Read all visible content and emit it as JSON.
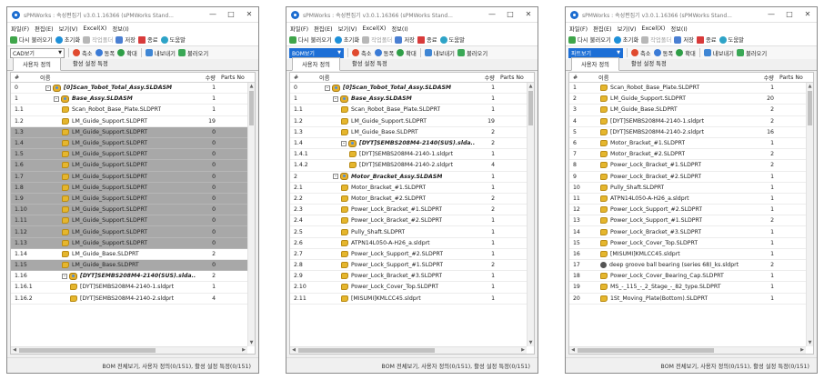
{
  "windows": [
    {
      "title": "sPMWorks : 속성편집기 v3.0.1.16366 (sPMWorks Stand...",
      "menu": [
        "파일(F)",
        "편집(E)",
        "보기(V)",
        "Excel(X)",
        "정보(I)"
      ],
      "toolbar": [
        "다시 불러오기",
        "초기화",
        "작업폴더",
        "저장",
        "종료",
        "도움말"
      ],
      "view_select": "CAD보기",
      "view_selected": false,
      "zoom": [
        "축소",
        "동폭",
        "확대"
      ],
      "io": [
        "내보내기",
        "불러오기"
      ],
      "tabs": [
        "사용자 정의",
        "활성 설정 특정"
      ],
      "columns": {
        "num": "#",
        "name": "이름",
        "qty": "수량",
        "parts": "Parts No"
      },
      "rows": [
        {
          "num": "0",
          "name": "[0]Scan_Tobot_Total_Assy.SLDASM",
          "qty": "1",
          "kind": "asm",
          "indent": 0,
          "hl": false,
          "exp": "-"
        },
        {
          "num": "1",
          "name": "Base_Assy.SLDASM",
          "qty": "1",
          "kind": "asm",
          "indent": 1,
          "hl": false,
          "exp": "-"
        },
        {
          "num": "1.1",
          "name": "Scan_Robot_Base_Plate.SLDPRT",
          "qty": "1",
          "kind": "part",
          "indent": 2,
          "hl": false
        },
        {
          "num": "1.2",
          "name": "LM_Guide_Support.SLDPRT",
          "qty": "19",
          "kind": "part",
          "indent": 2,
          "hl": false
        },
        {
          "num": "1.3",
          "name": "LM_Guide_Support.SLDPRT",
          "qty": "0",
          "kind": "part",
          "indent": 2,
          "hl": true
        },
        {
          "num": "1.4",
          "name": "LM_Guide_Support.SLDPRT",
          "qty": "0",
          "kind": "part",
          "indent": 2,
          "hl": true
        },
        {
          "num": "1.5",
          "name": "LM_Guide_Support.SLDPRT",
          "qty": "0",
          "kind": "part",
          "indent": 2,
          "hl": true
        },
        {
          "num": "1.6",
          "name": "LM_Guide_Support.SLDPRT",
          "qty": "0",
          "kind": "part",
          "indent": 2,
          "hl": true
        },
        {
          "num": "1.7",
          "name": "LM_Guide_Support.SLDPRT",
          "qty": "0",
          "kind": "part",
          "indent": 2,
          "hl": true
        },
        {
          "num": "1.8",
          "name": "LM_Guide_Support.SLDPRT",
          "qty": "0",
          "kind": "part",
          "indent": 2,
          "hl": true
        },
        {
          "num": "1.9",
          "name": "LM_Guide_Support.SLDPRT",
          "qty": "0",
          "kind": "part",
          "indent": 2,
          "hl": true
        },
        {
          "num": "1.10",
          "name": "LM_Guide_Support.SLDPRT",
          "qty": "0",
          "kind": "part",
          "indent": 2,
          "hl": true
        },
        {
          "num": "1.11",
          "name": "LM_Guide_Support.SLDPRT",
          "qty": "0",
          "kind": "part",
          "indent": 2,
          "hl": true
        },
        {
          "num": "1.12",
          "name": "LM_Guide_Support.SLDPRT",
          "qty": "0",
          "kind": "part",
          "indent": 2,
          "hl": true
        },
        {
          "num": "1.13",
          "name": "LM_Guide_Support.SLDPRT",
          "qty": "0",
          "kind": "part",
          "indent": 2,
          "hl": true
        },
        {
          "num": "1.14",
          "name": "LM_Guide_Base.SLDPRT",
          "qty": "2",
          "kind": "part",
          "indent": 2,
          "hl": false
        },
        {
          "num": "1.15",
          "name": "LM_Guide_Base.SLDPRT",
          "qty": "0",
          "kind": "part",
          "indent": 2,
          "hl": true
        },
        {
          "num": "1.16",
          "name": "[DYT]SEMBS208M4-2140(SUS).slda...",
          "qty": "2",
          "kind": "asm",
          "indent": 2,
          "hl": false,
          "exp": "-"
        },
        {
          "num": "1.16.1",
          "name": "[DYT]SEMBS208M4-2140-1.sldprt",
          "qty": "1",
          "kind": "part",
          "indent": 3,
          "hl": false
        },
        {
          "num": "1.16.2",
          "name": "[DYT]SEMBS208M4-2140-2.sldprt",
          "qty": "4",
          "kind": "part",
          "indent": 3,
          "hl": false
        }
      ],
      "status": "BOM 전체보기, 사용자 정의(0/151), 활성 설정 특정(0/151)"
    },
    {
      "title": "sPMWorks : 속성편집기 v3.0.1.16366 (sPMWorks Stand...",
      "menu": [
        "파일(F)",
        "편집(E)",
        "보기(V)",
        "Excel(X)",
        "정보(I)"
      ],
      "toolbar": [
        "다시 불러오기",
        "초기화",
        "작업폴더",
        "저장",
        "종료",
        "도움말"
      ],
      "view_select": "BOM보기",
      "view_selected": true,
      "zoom": [
        "축소",
        "동폭",
        "확대"
      ],
      "io": [
        "내보내기",
        "불러오기"
      ],
      "tabs": [
        "사용자 정의",
        "활성 설정 특정"
      ],
      "columns": {
        "num": "#",
        "name": "이름",
        "qty": "수량",
        "parts": "Parts No"
      },
      "rows": [
        {
          "num": "0",
          "name": "[0]Scan_Tobot_Total_Assy.SLDASM",
          "qty": "1",
          "kind": "asm",
          "indent": 0,
          "hl": false,
          "exp": "-"
        },
        {
          "num": "1",
          "name": "Base_Assy.SLDASM",
          "qty": "1",
          "kind": "asm",
          "indent": 1,
          "hl": false,
          "exp": "-"
        },
        {
          "num": "1.1",
          "name": "Scan_Robot_Base_Plate.SLDPRT",
          "qty": "1",
          "kind": "part",
          "indent": 2,
          "hl": false
        },
        {
          "num": "1.2",
          "name": "LM_Guide_Support.SLDPRT",
          "qty": "19",
          "kind": "part",
          "indent": 2,
          "hl": false
        },
        {
          "num": "1.3",
          "name": "LM_Guide_Base.SLDPRT",
          "qty": "2",
          "kind": "part",
          "indent": 2,
          "hl": false
        },
        {
          "num": "1.4",
          "name": "[DYT]SEMBS208M4-2140(SUS).slda...",
          "qty": "2",
          "kind": "asm",
          "indent": 2,
          "hl": false,
          "exp": "-"
        },
        {
          "num": "1.4.1",
          "name": "[DYT]SEMBS208M4-2140-1.sldprt",
          "qty": "1",
          "kind": "part",
          "indent": 3,
          "hl": false
        },
        {
          "num": "1.4.2",
          "name": "[DYT]SEMBS208M4-2140-2.sldprt",
          "qty": "4",
          "kind": "part",
          "indent": 3,
          "hl": false
        },
        {
          "num": "2",
          "name": "Motor_Bracket_Assy.SLDASM",
          "qty": "1",
          "kind": "asm",
          "indent": 1,
          "hl": false,
          "exp": "-"
        },
        {
          "num": "2.1",
          "name": "Motor_Bracket_#1.SLDPRT",
          "qty": "1",
          "kind": "part",
          "indent": 2,
          "hl": false
        },
        {
          "num": "2.2",
          "name": "Motor_Bracket_#2.SLDPRT",
          "qty": "2",
          "kind": "part",
          "indent": 2,
          "hl": false
        },
        {
          "num": "2.3",
          "name": "Power_Lock_Bracket_#1.SLDPRT",
          "qty": "2",
          "kind": "part",
          "indent": 2,
          "hl": false
        },
        {
          "num": "2.4",
          "name": "Power_Lock_Bracket_#2.SLDPRT",
          "qty": "1",
          "kind": "part",
          "indent": 2,
          "hl": false
        },
        {
          "num": "2.5",
          "name": "Pully_Shaft.SLDPRT",
          "qty": "1",
          "kind": "part",
          "indent": 2,
          "hl": false
        },
        {
          "num": "2.6",
          "name": "ATPN14L050-A-H26_a.sldprt",
          "qty": "1",
          "kind": "part",
          "indent": 2,
          "hl": false
        },
        {
          "num": "2.7",
          "name": "Power_Lock_Support_#2.SLDPRT",
          "qty": "1",
          "kind": "part",
          "indent": 2,
          "hl": false
        },
        {
          "num": "2.8",
          "name": "Power_Lock_Support_#1.SLDPRT",
          "qty": "2",
          "kind": "part",
          "indent": 2,
          "hl": false
        },
        {
          "num": "2.9",
          "name": "Power_Lock_Bracket_#3.SLDPRT",
          "qty": "1",
          "kind": "part",
          "indent": 2,
          "hl": false
        },
        {
          "num": "2.10",
          "name": "Power_Lock_Cover_Top.SLDPRT",
          "qty": "1",
          "kind": "part",
          "indent": 2,
          "hl": false
        },
        {
          "num": "2.11",
          "name": "[MISUMI]KMLCC45.sldprt",
          "qty": "1",
          "kind": "part",
          "indent": 2,
          "hl": false
        }
      ],
      "status": "BOM 전체보기, 사용자 정의(0/151), 활성 설정 특정(0/151)"
    },
    {
      "title": "sPMWorks : 속성편집기 v3.0.1.16366 (sPMWorks Stand...",
      "menu": [
        "파일(F)",
        "편집(E)",
        "보기(V)",
        "Excel(X)",
        "정보(I)"
      ],
      "toolbar": [
        "다시 불러오기",
        "초기화",
        "작업폴더",
        "저장",
        "종료",
        "도움말"
      ],
      "view_select": "파트보기",
      "view_selected": true,
      "zoom": [
        "축소",
        "동폭",
        "확대"
      ],
      "io": [
        "내보내기",
        "불러오기"
      ],
      "tabs": [
        "사용자 정의",
        "활성 설정 특정"
      ],
      "columns": {
        "num": "#",
        "name": "이름",
        "qty": "수량",
        "parts": "Parts No"
      },
      "rows": [
        {
          "num": "1",
          "name": "Scan_Robot_Base_Plate.SLDPRT",
          "qty": "1",
          "kind": "part",
          "indent": 0,
          "hl": false
        },
        {
          "num": "2",
          "name": "LM_Guide_Support.SLDPRT",
          "qty": "20",
          "kind": "part",
          "indent": 0,
          "hl": false
        },
        {
          "num": "3",
          "name": "LM_Guide_Base.SLDPRT",
          "qty": "2",
          "kind": "part",
          "indent": 0,
          "hl": false
        },
        {
          "num": "4",
          "name": "[DYT]SEMBS208M4-2140-1.sldprt",
          "qty": "2",
          "kind": "part",
          "indent": 0,
          "hl": false
        },
        {
          "num": "5",
          "name": "[DYT]SEMBS208M4-2140-2.sldprt",
          "qty": "16",
          "kind": "part",
          "indent": 0,
          "hl": false
        },
        {
          "num": "6",
          "name": "Motor_Bracket_#1.SLDPRT",
          "qty": "1",
          "kind": "part",
          "indent": 0,
          "hl": false
        },
        {
          "num": "7",
          "name": "Motor_Bracket_#2.SLDPRT",
          "qty": "2",
          "kind": "part",
          "indent": 0,
          "hl": false
        },
        {
          "num": "8",
          "name": "Power_Lock_Bracket_#1.SLDPRT",
          "qty": "2",
          "kind": "part",
          "indent": 0,
          "hl": false
        },
        {
          "num": "9",
          "name": "Power_Lock_Bracket_#2.SLDPRT",
          "qty": "1",
          "kind": "part",
          "indent": 0,
          "hl": false
        },
        {
          "num": "10",
          "name": "Pully_Shaft.SLDPRT",
          "qty": "1",
          "kind": "part",
          "indent": 0,
          "hl": false
        },
        {
          "num": "11",
          "name": "ATPN14L050-A-H26_a.sldprt",
          "qty": "1",
          "kind": "part",
          "indent": 0,
          "hl": false
        },
        {
          "num": "12",
          "name": "Power_Lock_Support_#2.SLDPRT",
          "qty": "1",
          "kind": "part",
          "indent": 0,
          "hl": false
        },
        {
          "num": "13",
          "name": "Power_Lock_Support_#1.SLDPRT",
          "qty": "2",
          "kind": "part",
          "indent": 0,
          "hl": false
        },
        {
          "num": "14",
          "name": "Power_Lock_Bracket_#3.SLDPRT",
          "qty": "1",
          "kind": "part",
          "indent": 0,
          "hl": false
        },
        {
          "num": "15",
          "name": "Power_Lock_Cover_Top.SLDPRT",
          "qty": "1",
          "kind": "part",
          "indent": 0,
          "hl": false
        },
        {
          "num": "16",
          "name": "[MISUMI]KMLCC45.sldprt",
          "qty": "1",
          "kind": "part",
          "indent": 0,
          "hl": false
        },
        {
          "num": "17",
          "name": "deep groove ball bearing (series 68)_ks.sldprt",
          "qty": "2",
          "kind": "ball",
          "indent": 0,
          "hl": false
        },
        {
          "num": "18",
          "name": "Power_Lock_Cover_Bearing_Cap.SLDPRT",
          "qty": "1",
          "kind": "part",
          "indent": 0,
          "hl": false
        },
        {
          "num": "19",
          "name": "MS_-_115_-_2_Stage_-_82_type.SLDPRT",
          "qty": "1",
          "kind": "part",
          "indent": 0,
          "hl": false
        },
        {
          "num": "20",
          "name": "1St_Moving_Plate(Bottom).SLDPRT",
          "qty": "1",
          "kind": "part",
          "indent": 0,
          "hl": false
        }
      ],
      "status": "BOM 전체보기, 사용자 정의(0/151), 활성 설정 특정(0/151)"
    }
  ]
}
